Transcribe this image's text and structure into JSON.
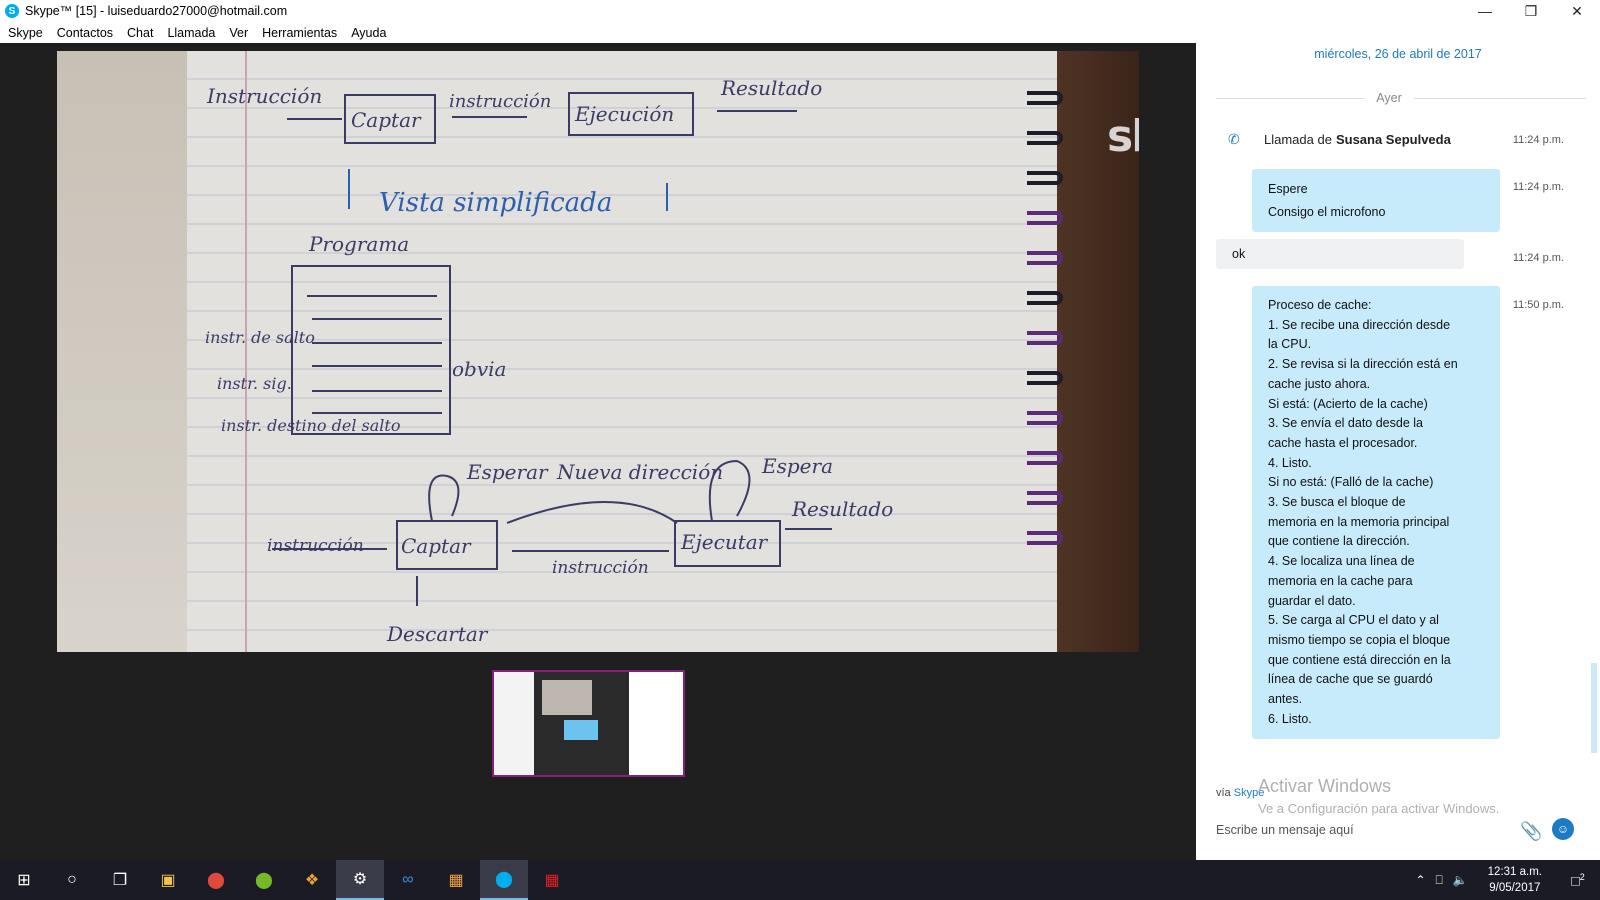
{
  "window": {
    "title": "Skype™ [15] - luiseduardo27000@hotmail.com",
    "logo_letter": "S"
  },
  "menu": [
    "Skype",
    "Contactos",
    "Chat",
    "Llamada",
    "Ver",
    "Herramientas",
    "Ayuda"
  ],
  "video": {
    "watermark": "skype",
    "sketch_labels": {
      "instruccion": "Instrucción",
      "captar": "Captar",
      "instruccion2": "instrucción",
      "ejecucion": "Ejecución",
      "resultado": "Resultado",
      "vista": "Vista simplificada",
      "programa": "Programa",
      "instr_salto": "instr. de salto",
      "instr_sig": "instr. sig.",
      "instr_destino": "instr. destino del salto",
      "obvia": "obvia",
      "esperar": "Esperar",
      "nueva_direccion": "Nueva dirección",
      "espera": "Espera",
      "instruccion3": "instrucción",
      "captar2": "Captar",
      "instruccion4": "instrucción",
      "ejecutar": "Ejecutar",
      "resultado2": "Resultado",
      "descartar": "Descartar"
    }
  },
  "chat": {
    "date_header": "miércoles, 26 de abril de 2017",
    "day_divider": "Ayer",
    "call": {
      "prefix": "Llamada de ",
      "name": "Susana  Sepulveda",
      "time": "11:24 p.m."
    },
    "messages": [
      {
        "dir": "out",
        "lines": [
          "Espere",
          "Consigo el microfono"
        ],
        "time": "11:24 p.m."
      },
      {
        "dir": "in",
        "lines": [
          "ok"
        ],
        "time": "11:24 p.m."
      },
      {
        "dir": "out",
        "lines": [
          "Proceso de cache:",
          "1. Se recibe una dirección desde",
          "la CPU.",
          "2. Se revisa si la dirección está en",
          "cache justo ahora.",
          "Si está: (Acierto de la cache)",
          "3. Se envía el dato desde la",
          "cache hasta el procesador.",
          "4. Listo.",
          "Si no está: (Falló de la cache)",
          "3. Se busca el bloque de",
          "memoria en la memoria principal",
          "que contiene la dirección.",
          "4. Se localiza una línea de",
          "memoria en la cache para",
          "guardar el dato.",
          "5. Se carga al CPU el dato y al",
          "mismo tiempo se copia el bloque",
          "que contiene está dirección en la",
          "línea de cache que se guardó",
          "antes.",
          "6. Listo."
        ],
        "time": "11:50 p.m."
      }
    ],
    "via_prefix": "vía ",
    "via_link": "Skype",
    "activate_title": "Activar Windows",
    "activate_sub": "Ve a Configuración para activar Windows.",
    "input_placeholder": "Escribe un mensaje aquí"
  },
  "taskbar": {
    "time": "12:31 a.m.",
    "date": "9/05/2017",
    "notifications": "2"
  }
}
